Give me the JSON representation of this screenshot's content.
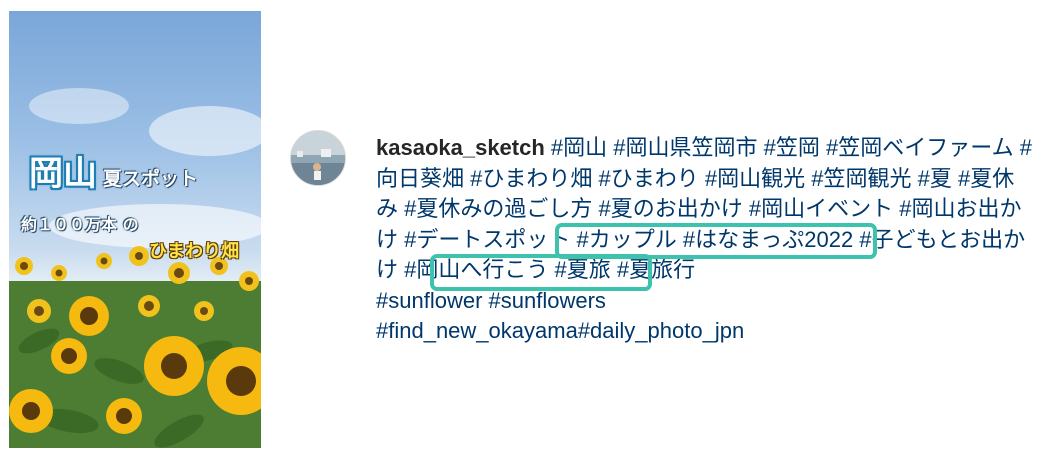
{
  "post_image": {
    "title_big": "岡山",
    "title_sub": "夏スポット",
    "line2": "約１００万本 の",
    "line3": "ひまわり畑"
  },
  "comment": {
    "username": "kasaoka_sketch",
    "tags": [
      "#岡山",
      "#岡山県笠岡市",
      "#笠岡",
      "#笠岡ベイファーム",
      "#向日葵畑",
      "#ひまわり畑",
      "#ひまわり",
      "#岡山観光",
      "#笠岡観光",
      "#夏",
      "#夏休み",
      "#夏休みの過ごし方",
      "#夏のお出かけ",
      "#岡山イベント",
      "#岡山お出かけ",
      "#デートスポット",
      "#カップル",
      "#はなまっぷ2022",
      "#子どもとお出かけ",
      "#岡山へ行こう",
      "#夏旅",
      "#夏旅行",
      "#sunflower",
      "#sunflowers",
      "#find_new_okayama",
      "#daily_photo_jpn"
    ]
  },
  "colors": {
    "highlight": "#3cc2ad",
    "hashtag": "#00376b",
    "username": "#262626"
  }
}
